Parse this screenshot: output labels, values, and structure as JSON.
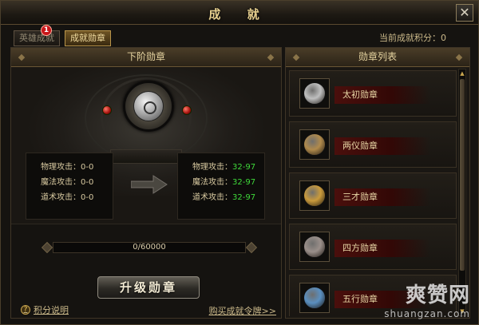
{
  "window": {
    "title": "成 就",
    "close_label": "✕"
  },
  "tabs": [
    {
      "label": "英雄成就",
      "active": false,
      "badge": "1"
    },
    {
      "label": "成就勋章",
      "active": true
    }
  ],
  "points": {
    "label": "当前成就积分：0"
  },
  "left_panel": {
    "header": "下阶勋章",
    "current_stats": [
      {
        "label": "物理攻击：",
        "value": "0-0"
      },
      {
        "label": "魔法攻击：",
        "value": "0-0"
      },
      {
        "label": "道术攻击：",
        "value": "0-0"
      }
    ],
    "next_stats": [
      {
        "label": "物理攻击：",
        "value": "32-97"
      },
      {
        "label": "魔法攻击：",
        "value": "32-97"
      },
      {
        "label": "道术攻击：",
        "value": "32-97"
      }
    ],
    "progress": {
      "text": "0/60000",
      "fraction": 0
    },
    "upgrade_label": "升级勋章",
    "help_label": "积分说明",
    "help_icon": "?",
    "buy_label": "购买成就令牌>>"
  },
  "right_panel": {
    "header": "勋章列表",
    "medals": [
      {
        "label": "太初勋章",
        "icon": "silver-medal-icon",
        "color": "#bfbfbf"
      },
      {
        "label": "两仪勋章",
        "icon": "bronze-medal-icon",
        "color": "#b08a4c"
      },
      {
        "label": "三才勋章",
        "icon": "gold-medal-icon",
        "color": "#c99a3c"
      },
      {
        "label": "四方勋章",
        "icon": "silver-red-medal-icon",
        "color": "#9a8f8a"
      },
      {
        "label": "五行勋章",
        "icon": "gold-blue-medal-icon",
        "color": "#5a8fc0"
      }
    ]
  },
  "watermark": {
    "cn": "爽赞网",
    "en": "shuangzan.com"
  }
}
